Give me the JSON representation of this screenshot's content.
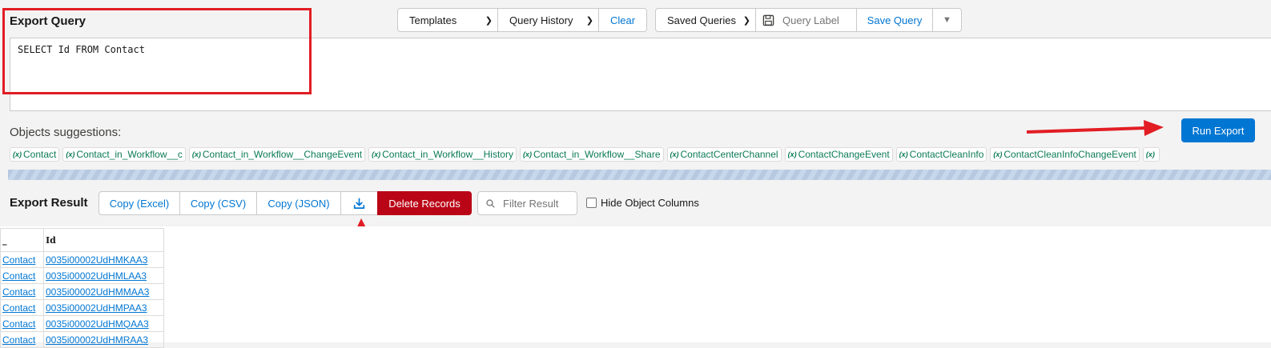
{
  "export_query": {
    "title": "Export Query",
    "query": "SELECT Id FROM Contact"
  },
  "toolbar": {
    "templates_label": "Templates",
    "query_history_label": "Query History",
    "clear_label": "Clear",
    "saved_queries_label": "Saved Queries",
    "query_label_placeholder": "Query Label",
    "save_query_label": "Save Query"
  },
  "objects": {
    "label": "Objects suggestions:",
    "suggestions": [
      "Contact",
      "Contact_in_Workflow__c",
      "Contact_in_Workflow__ChangeEvent",
      "Contact_in_Workflow__History",
      "Contact_in_Workflow__Share",
      "ContactCenterChannel",
      "ContactChangeEvent",
      "ContactCleanInfo",
      "ContactCleanInfoChangeEvent"
    ]
  },
  "run_export_label": "Run Export",
  "export_result": {
    "title": "Export Result",
    "copy_excel_label": "Copy (Excel)",
    "copy_csv_label": "Copy (CSV)",
    "copy_json_label": "Copy (JSON)",
    "delete_label": "Delete Records",
    "filter_placeholder": "Filter Result",
    "hide_columns_label": "Hide Object Columns"
  },
  "table": {
    "columns": [
      "_",
      "Id"
    ],
    "rows": [
      [
        "Contact",
        "0035i00002UdHMKAA3"
      ],
      [
        "Contact",
        "0035i00002UdHMLAA3"
      ],
      [
        "Contact",
        "0035i00002UdHMMAA3"
      ],
      [
        "Contact",
        "0035i00002UdHMPAA3"
      ],
      [
        "Contact",
        "0035i00002UdHMQAA3"
      ],
      [
        "Contact",
        "0035i00002UdHMRAA3"
      ]
    ]
  },
  "colors": {
    "annotation_red": "#e21d24",
    "brand_blue": "#0176d3",
    "danger_red": "#ba0517"
  }
}
